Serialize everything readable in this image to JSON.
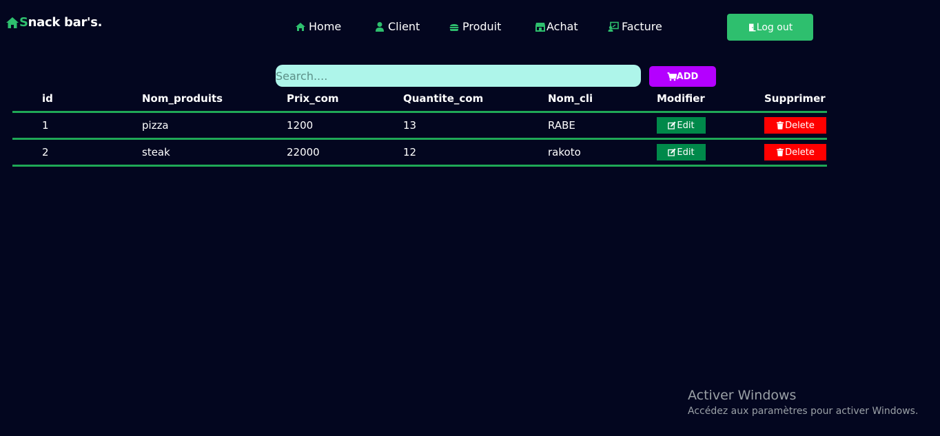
{
  "brand": {
    "icon": "home-icon",
    "first_letter": "S",
    "rest": "nack bar's.",
    "accent_color": "#2ebf6e"
  },
  "nav": {
    "items": [
      {
        "label": "Home",
        "icon": "home-icon"
      },
      {
        "label": "Client",
        "icon": "user-icon"
      },
      {
        "label": "Produit",
        "icon": "burger-icon"
      },
      {
        "label": "Achat",
        "icon": "store-icon"
      },
      {
        "label": "Facture",
        "icon": "invoice-icon"
      }
    ],
    "logout_label": "Log out",
    "logout_icon": "door-icon"
  },
  "toolbar": {
    "search_placeholder": "Search....",
    "add_label": "ADD",
    "add_icon": "cart-icon",
    "add_color": "#b400ff"
  },
  "table": {
    "headers": [
      "id",
      "Nom_produits",
      "Prix_com",
      "Quantite_com",
      "Nom_cli",
      "Modifier",
      "Supprimer"
    ],
    "rows": [
      {
        "id": "1",
        "nom_produits": "pizza",
        "prix_com": "1200",
        "quantite_com": "13",
        "nom_cli": "RABE",
        "edit_label": "Edit",
        "delete_label": "Delete"
      },
      {
        "id": "2",
        "nom_produits": "steak",
        "prix_com": "22000",
        "quantite_com": "12",
        "nom_cli": "rakoto",
        "edit_label": "Edit",
        "delete_label": "Delete"
      }
    ],
    "border_color": "#1fa856",
    "edit_color": "#00894a",
    "delete_color": "#ff0000"
  },
  "watermark": {
    "title": "Activer Windows",
    "subtitle": "Accédez aux paramètres pour activer Windows."
  }
}
